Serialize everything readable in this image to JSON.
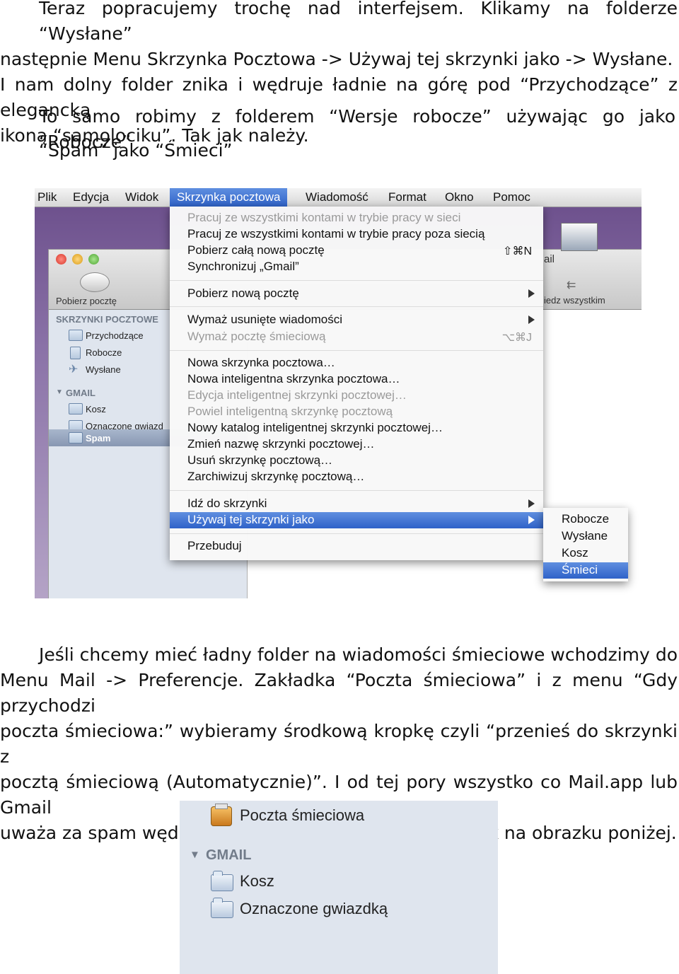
{
  "paragraph1": {
    "line1": "Teraz popracujemy trochę nad interfejsem. Klikamy na folderze “Wysłane”",
    "line2": "następnie Menu Skrzynka Pocztowa -> Używaj tej skrzynki jako -> Wysłane.",
    "line3": "I nam dolny folder znika i wędruje ładnie na górę pod “Przychodzące” z elegancką",
    "line4": "ikoną “samolociku”. Tak jak należy."
  },
  "paragraph2": "To samo robimy z folderem “Wersje robocze” używając go jako “Robocze”",
  "paragraph3": "“Spam” jako “Śmieci”",
  "paragraph4": {
    "line1": "Jeśli chcemy mieć ładny folder na wiadomości śmieciowe wchodzimy do",
    "line2": "Menu Mail -> Preferencje. Zakładka “Poczta śmieciowa” i z menu “Gdy przychodzi",
    "line3": "poczta śmieciowa:” wybieramy środkową kropkę czyli “przenieś do skrzynki z",
    "line4": "pocztą śmieciową (Automatycznie)”. I od tej pory wszystko co Mail.app lub Gmail",
    "line5": "uważa za spam wędruje do Poczty śmieciowej, takiej jak na obrazku poniżej."
  },
  "screenshot1": {
    "menubar": [
      "Plik",
      "Edycja",
      "Widok",
      "Skrzynka pocztowa",
      "Wiadomość",
      "Format",
      "Okno",
      "Pomoc"
    ],
    "toolbar_get_mail": "Pobierz pocztę",
    "toolbar_right_partial": "ail",
    "toolbar_right_partial2": "iedz wszystkim",
    "sidebar": {
      "section1": "SKRZYNKI POCZTOWE",
      "items1": [
        "Przychodzące",
        "Robocze",
        "Wysłane"
      ],
      "section2": "GMAIL",
      "items2": [
        "Kosz",
        "Oznaczone gwiazd",
        "Spam"
      ]
    },
    "menu": {
      "items": [
        "Pracuj ze wszystkimi kontami w trybie pracy w sieci",
        "Pracuj ze wszystkimi kontami w trybie pracy poza siecią",
        "Pobierz całą nową pocztę",
        "Synchronizuj „Gmail”",
        "Pobierz nową pocztę",
        "Wymaż usunięte wiadomości",
        "Wymaż pocztę śmieciową",
        "Nowa skrzynka pocztowa…",
        "Nowa inteligentna skrzynka pocztowa…",
        "Edycja inteligentnej skrzynki pocztowej…",
        "Powiel inteligentną skrzynkę pocztową",
        "Nowy katalog inteligentnej skrzynki pocztowej…",
        "Zmień nazwę skrzynki pocztowej…",
        "Usuń skrzynkę pocztową…",
        "Zarchiwizuj skrzynkę pocztową…",
        "Idź do skrzynki",
        "Używaj tej skrzynki jako",
        "Przebuduj"
      ],
      "shortcut_get_all": "⇧⌘N",
      "shortcut_erase_junk": "⌥⌘J"
    },
    "submenu": [
      "Robocze",
      "Wysłane",
      "Kosz",
      "Śmieci"
    ]
  },
  "screenshot2": {
    "junk": "Poczta śmieciowa",
    "section": "GMAIL",
    "items": [
      "Kosz",
      "Oznaczone gwiazdką"
    ]
  }
}
